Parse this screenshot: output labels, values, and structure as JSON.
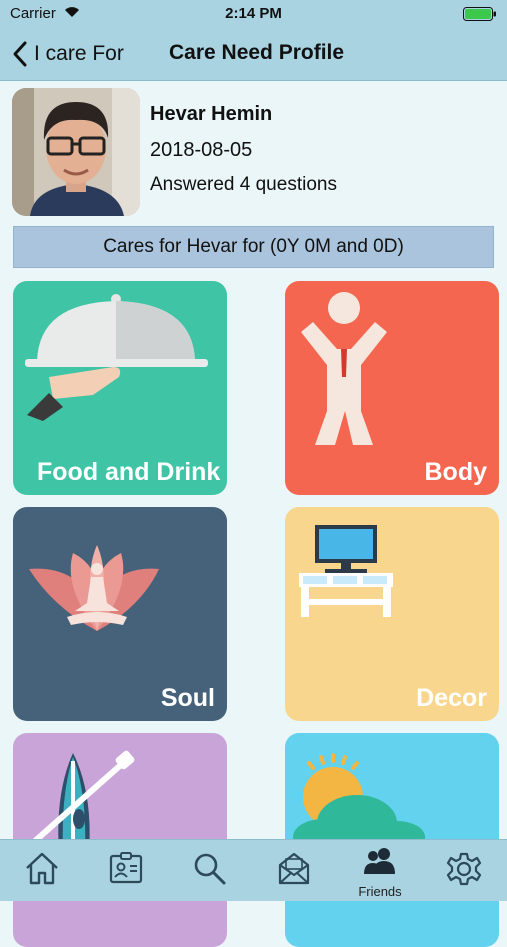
{
  "status": {
    "carrier": "Carrier",
    "time": "2:14 PM"
  },
  "nav": {
    "back_label": "I care For",
    "title": "Care Need Profile"
  },
  "profile": {
    "name": "Hevar Hemin",
    "date": "2018-08-05",
    "answered": "Answered 4 questions"
  },
  "cares_banner": "Cares for Hevar for (0Y 0M and 0D)",
  "tiles": [
    {
      "label": "Food and Drink",
      "color": "#3fc4a6",
      "icon": "food-cloche-icon"
    },
    {
      "label": "Body",
      "color": "#f56650",
      "icon": "body-figure-icon"
    },
    {
      "label": "Soul",
      "color": "#46627a",
      "icon": "lotus-meditation-icon"
    },
    {
      "label": "Decor",
      "color": "#f8d68e",
      "icon": "tv-stand-icon"
    },
    {
      "label": "",
      "color": "#c9a4d8",
      "icon": "paddle-board-icon"
    },
    {
      "label": "",
      "color": "#62d2ee",
      "icon": "sun-cloud-icon"
    }
  ],
  "tabs": [
    {
      "icon": "home-icon",
      "label": ""
    },
    {
      "icon": "id-card-icon",
      "label": ""
    },
    {
      "icon": "search-icon",
      "label": ""
    },
    {
      "icon": "mail-icon",
      "label": ""
    },
    {
      "icon": "friends-icon",
      "label": "Friends"
    },
    {
      "icon": "gear-icon",
      "label": ""
    }
  ],
  "colors": {
    "bar": "#a9d3e0",
    "background": "#eaf6f7",
    "banner": "#a9c4dc"
  }
}
